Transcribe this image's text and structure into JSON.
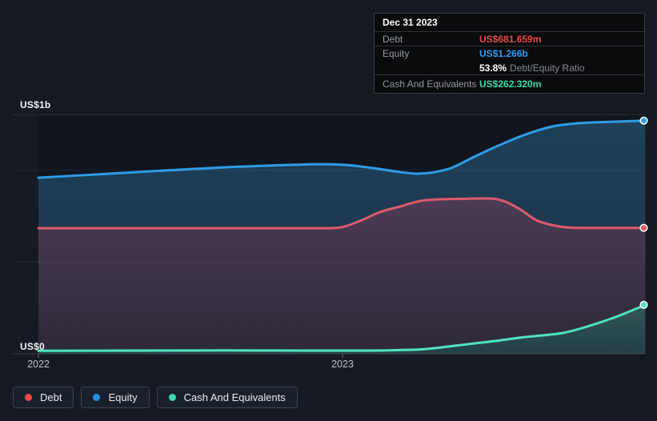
{
  "y_axis": {
    "top_label": "US$1b",
    "bottom_label": "US$0"
  },
  "x_axis": {
    "ticks": [
      {
        "label": "2022",
        "f": 0.0
      },
      {
        "label": "2023",
        "f": 0.501
      }
    ]
  },
  "tooltip": {
    "date": "Dec 31 2023",
    "debt_label": "Debt",
    "debt_value": "US$681.659m",
    "equity_label": "Equity",
    "equity_value": "US$1.266b",
    "ratio_value": "53.8%",
    "ratio_label": "Debt/Equity Ratio",
    "cash_label": "Cash And Equivalents",
    "cash_value": "US$262.320m"
  },
  "legend": {
    "debt": "Debt",
    "equity": "Equity",
    "cash": "Cash And Equivalents"
  },
  "colors": {
    "debt_line": "#dc5b69",
    "equity_line": "#2d9de8",
    "cash_line": "#4fe3c1",
    "debt_value_text": "#ec4742",
    "equity_value_text": "#2a9df4",
    "cash_value_text": "#38dcae",
    "debt_legend_dot": "#e8484d",
    "equity_legend_dot": "#2191e0",
    "cash_legend_dot": "#41d9b4"
  },
  "chart_data": {
    "type": "area",
    "title": "Debt to Equity history",
    "x_range": [
      "2022",
      "Dec 31 2023"
    ],
    "y_unit": "USD billions",
    "ylim": [
      0,
      1.3
    ],
    "gridline_values": [
      0.5,
      1.0
    ],
    "legend_position": "bottom-left",
    "highlighted_point": {
      "date": "Dec 31 2023",
      "debt_b": 0.681659,
      "equity_b": 1.266,
      "cash_b": 0.26232,
      "debt_equity_ratio_pct": 53.8
    },
    "series": [
      {
        "id": "equity",
        "name": "Equity",
        "points": [
          [
            0.0,
            0.955
          ],
          [
            0.108,
            0.975
          ],
          [
            0.214,
            0.995
          ],
          [
            0.332,
            1.015
          ],
          [
            0.451,
            1.028
          ],
          [
            0.504,
            1.025
          ],
          [
            0.55,
            1.008
          ],
          [
            0.623,
            0.977
          ],
          [
            0.675,
            1.002
          ],
          [
            0.715,
            1.064
          ],
          [
            0.758,
            1.13
          ],
          [
            0.803,
            1.191
          ],
          [
            0.847,
            1.234
          ],
          [
            0.89,
            1.252
          ],
          [
            0.939,
            1.259
          ],
          [
            1.0,
            1.266
          ]
        ]
      },
      {
        "id": "debt",
        "name": "Debt",
        "points": [
          [
            0.0,
            0.68
          ],
          [
            0.15,
            0.68
          ],
          [
            0.3,
            0.68
          ],
          [
            0.45,
            0.68
          ],
          [
            0.497,
            0.684
          ],
          [
            0.53,
            0.72
          ],
          [
            0.563,
            0.768
          ],
          [
            0.596,
            0.798
          ],
          [
            0.636,
            0.832
          ],
          [
            0.7,
            0.84
          ],
          [
            0.755,
            0.838
          ],
          [
            0.79,
            0.79
          ],
          [
            0.82,
            0.724
          ],
          [
            0.848,
            0.696
          ],
          [
            0.873,
            0.684
          ],
          [
            0.93,
            0.681
          ],
          [
            1.0,
            0.6817
          ]
        ]
      },
      {
        "id": "cash",
        "name": "Cash And Equivalents",
        "points": [
          [
            0.0,
            0.012
          ],
          [
            0.15,
            0.013
          ],
          [
            0.3,
            0.014
          ],
          [
            0.45,
            0.013
          ],
          [
            0.55,
            0.013
          ],
          [
            0.6,
            0.016
          ],
          [
            0.64,
            0.022
          ],
          [
            0.7,
            0.045
          ],
          [
            0.75,
            0.064
          ],
          [
            0.8,
            0.086
          ],
          [
            0.86,
            0.107
          ],
          [
            0.9,
            0.14
          ],
          [
            0.95,
            0.195
          ],
          [
            1.0,
            0.2623
          ]
        ]
      }
    ]
  }
}
